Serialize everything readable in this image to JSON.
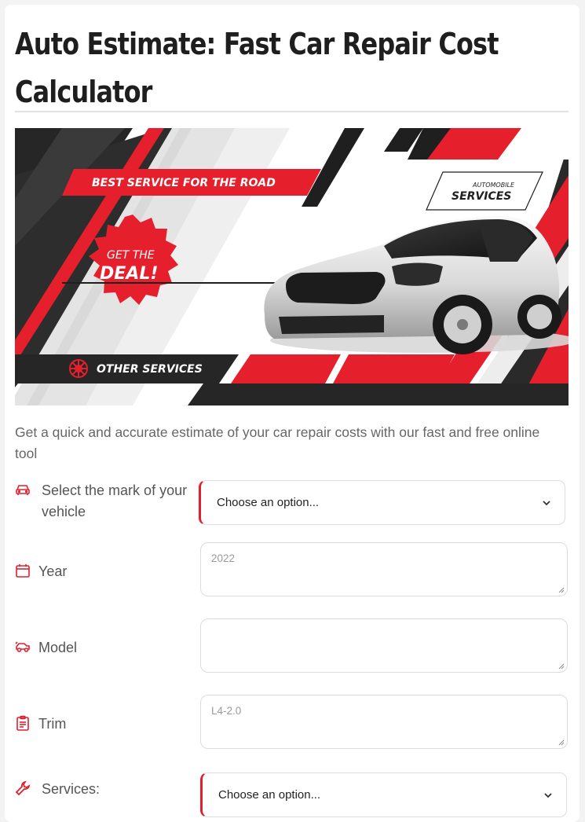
{
  "page": {
    "title": "Auto Estimate: Fast Car Repair Cost Calculator",
    "title_line1": "Auto Estimate: Fast Car Repair Cost",
    "title_line2": "Calculator",
    "intro": "Get a quick and accurate estimate of your car repair costs with our fast and free online tool"
  },
  "banner": {
    "headline": "BEST SERVICE FOR THE ROAD",
    "badge_line1": "GET THE",
    "badge_line2": "DEAL!",
    "tag_small": "AUTOMOBILE",
    "tag_large": "SERVICES",
    "footer": "OTHER SERVICES",
    "colors": {
      "red": "#e5202c",
      "dark": "#222222",
      "light": "#e6e6e6"
    }
  },
  "form": {
    "make": {
      "icon": "car-icon",
      "label_line1": "Select the mark of your",
      "label_line2": "vehicle",
      "value": "Choose an option..."
    },
    "year": {
      "icon": "calendar-icon",
      "label": "Year",
      "placeholder": "2022"
    },
    "model": {
      "icon": "car-side-icon",
      "label": "Model",
      "placeholder": ""
    },
    "trim": {
      "icon": "clipboard-icon",
      "label": "Trim",
      "placeholder": "L4-2.0"
    },
    "services": {
      "icon": "wrench-icon",
      "label": "Services:",
      "value": "Choose an option..."
    },
    "accent_color": "#e0202f"
  }
}
